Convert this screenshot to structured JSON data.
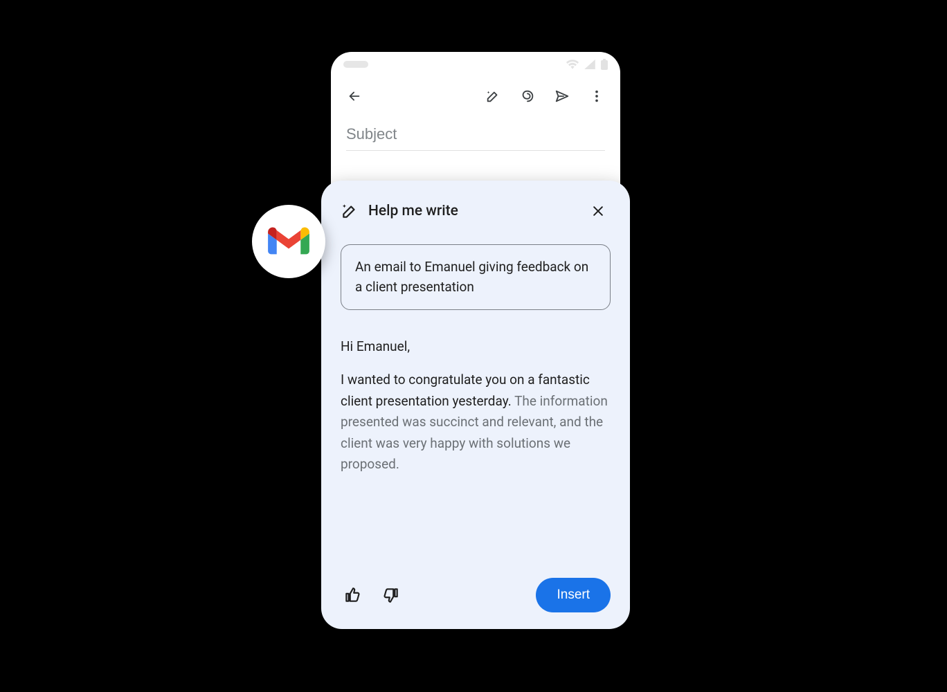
{
  "phone": {
    "subject_placeholder": "Subject"
  },
  "sheet": {
    "title": "Help me write",
    "prompt": "An email to Emanuel giving feedback on a client presentation",
    "draft": {
      "greeting": "Hi Emanuel,",
      "line1": "I wanted to congratulate you on a fantastic client presentation yesterday.",
      "line2": "The information presented was succinct and relevant, and the client was very happy with solutions we proposed."
    },
    "insert_label": "Insert"
  },
  "icons": {
    "back": "arrow-back",
    "magic_pen": "magic-pen",
    "attach": "attachment",
    "send": "send",
    "more": "more-vert",
    "close": "close",
    "thumbs_up": "thumbs-up",
    "thumbs_down": "thumbs-down",
    "gmail": "gmail-logo",
    "wifi": "wifi",
    "signal": "cellular",
    "battery": "battery"
  }
}
